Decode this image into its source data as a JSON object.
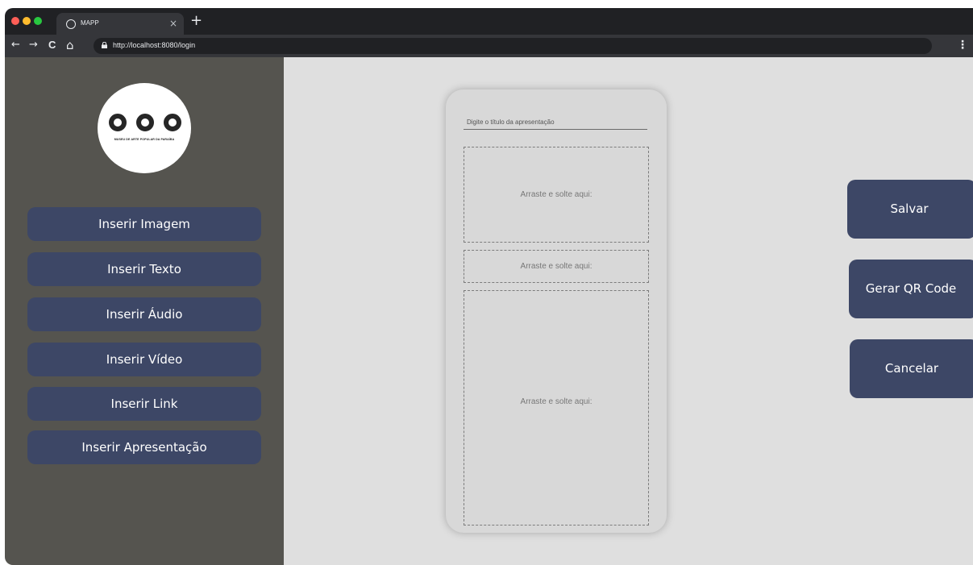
{
  "browser": {
    "tab_title": "MAPP",
    "tab_close": "×",
    "new_tab": "+",
    "url": "http://localhost:8080/login",
    "nav": {
      "back": "←",
      "forward": "→",
      "reload": "C",
      "home": "⌂"
    },
    "menu": "⋮"
  },
  "sidebar": {
    "logo_text": "MUSEU DE ARTE POPULAR DA PARAÍBA",
    "buttons": [
      "Inserir Imagem",
      "Inserir Texto",
      "Inserir Áudio",
      "Inserir Vídeo",
      "Inserir Link",
      "Inserir Apresentação"
    ]
  },
  "canvas": {
    "title_placeholder": "Digite o título da apresentação",
    "drop_zones": [
      "Arraste e solte aqui:",
      "Arraste e solte aqui:",
      "Arraste e solte aqui:"
    ]
  },
  "actions": {
    "save": "Salvar",
    "qr": "Gerar QR Code",
    "cancel": "Cancelar"
  },
  "colors": {
    "sidebar_bg": "#55544f",
    "button_bg": "#3d4766",
    "content_bg": "#dfdfdf"
  }
}
